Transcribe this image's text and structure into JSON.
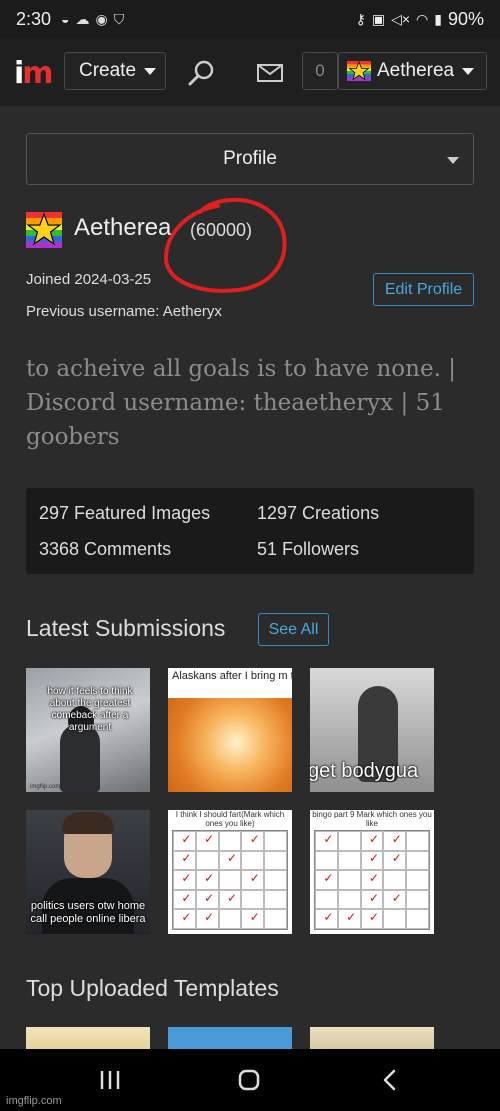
{
  "status_bar": {
    "time": "2:30",
    "battery": "90%"
  },
  "nav": {
    "logo": {
      "left": "i",
      "right": "m"
    },
    "create_label": "Create",
    "notifications_count": "0",
    "user_label": "Aetherea"
  },
  "profile_menu": {
    "selected": "Profile"
  },
  "profile": {
    "username": "Aetherea",
    "points": "(60000)",
    "joined": "Joined 2024-03-25",
    "previous_username": "Previous username: Aetheryx",
    "edit_button": "Edit Profile",
    "bio": "to acheive all goals is to have none. | Discord username: theaetheryx | 51 goobers"
  },
  "stats": {
    "featured": "297 Featured Images",
    "creations": "1297 Creations",
    "comments": "3368 Comments",
    "followers": "51 Followers"
  },
  "latest": {
    "title": "Latest Submissions",
    "see_all": "See All",
    "items": [
      {
        "caption": "how it feels to think about the greatest comeback after a argument",
        "watermark": "imgflip.com"
      },
      {
        "caption": "Alaskans after I bring m to Florida in the summ"
      },
      {
        "caption": "get bodygua"
      },
      {
        "caption": "politics users otw home call people online libera"
      },
      {
        "caption": "I think I should fart(Mark which ones you like)"
      },
      {
        "caption": "bingo part 9 Mark which ones you like"
      }
    ]
  },
  "templates": {
    "title": "Top Uploaded Templates"
  },
  "watermark": "imgflip.com",
  "colors": {
    "accent": "#2f8fc9",
    "brand_red": "#e63030",
    "background": "#2b2b2b",
    "annotation": "#e02020"
  }
}
